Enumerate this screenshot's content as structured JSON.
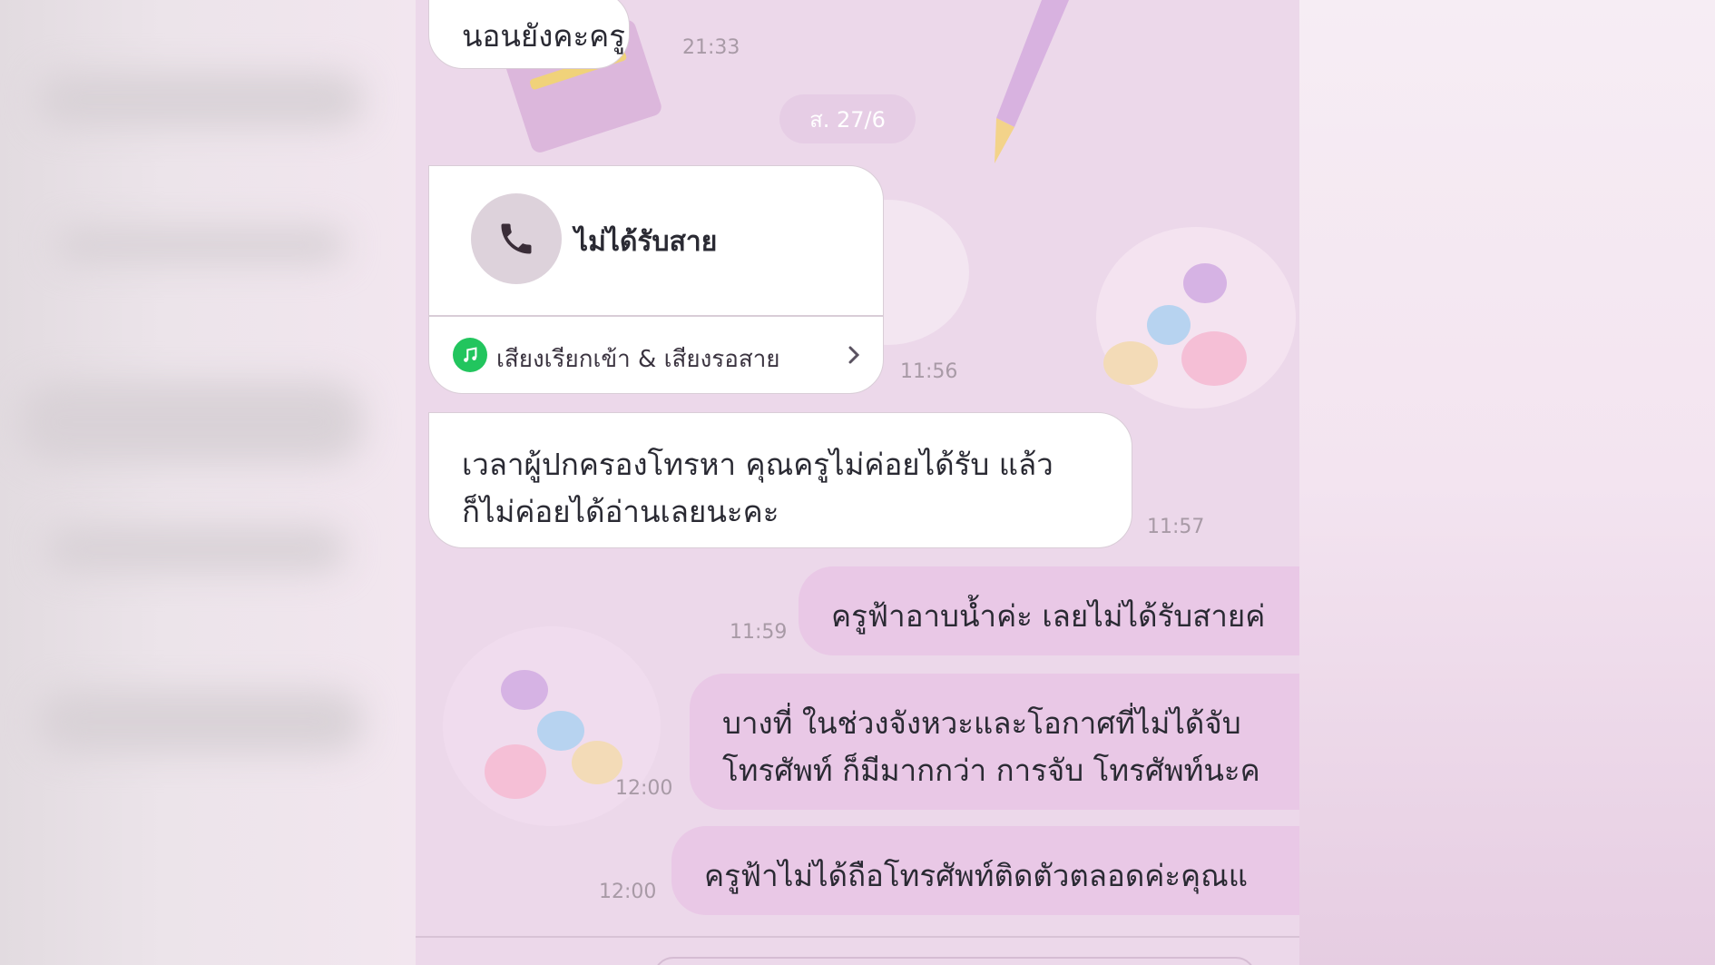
{
  "messages": [
    {
      "id": "m1",
      "side": "in",
      "text": "นอนยังคะครู",
      "time": "21:33"
    },
    {
      "id": "m3",
      "side": "in",
      "type": "missed-call",
      "title": "ไม่ได้รับสาย",
      "link_label": "เสียงเรียกเข้า & เสียงรอสาย",
      "time": "11:56"
    },
    {
      "id": "m4",
      "side": "in",
      "lines": [
        "เวลาผู้ปกครองโทรหา คุณครูไม่ค่อยได้รับ แล้ว",
        "ก็ไม่ค่อยได้อ่านเลยนะคะ"
      ],
      "time": "11:57"
    },
    {
      "id": "m5",
      "side": "out",
      "text": "ครูฟ้าอาบน้ำค่ะ เลยไม่ได้รับสายค่",
      "time": "11:59"
    },
    {
      "id": "m6",
      "side": "out",
      "lines": [
        "บางที่ ในช่วงจังหวะและโอกาศที่ไม่ได้จับ",
        "โทรศัพท์ ก็มีมากกว่า การจับ โทรศัพท์นะค"
      ],
      "time": "12:00"
    },
    {
      "id": "m7",
      "side": "out",
      "text": "ครูฟ้าไม่ได้ถือโทรศัพท์ติดตัวตลอดค่ะคุณแ",
      "time": "12:00"
    }
  ],
  "date_separator": "ส. 27/6",
  "icons": {
    "call": "phone-icon",
    "music": "music-note-icon",
    "chevron": "chevron-right-icon"
  },
  "colors": {
    "chat_bg": "#ecd8ea",
    "incoming": "#ffffff",
    "outgoing": "#e9c8e6",
    "music_green": "#22c55e"
  }
}
